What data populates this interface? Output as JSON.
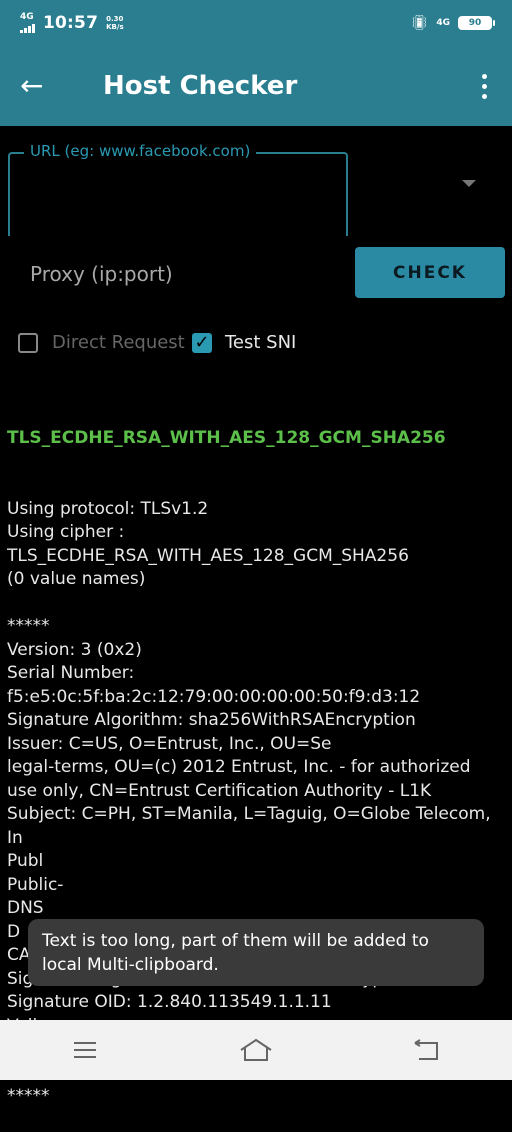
{
  "status": {
    "network": "4G",
    "time": "10:57",
    "speed_value": "0.30",
    "speed_unit": "KB/s",
    "network_right": "4G",
    "battery": "90"
  },
  "appbar": {
    "title": "Host Checker"
  },
  "form": {
    "url_label": "URL (eg: www.facebook.com)",
    "proxy_placeholder": "Proxy (ip:port)",
    "check_label": "CHECK",
    "direct_request_label": "Direct Request",
    "test_sni_label": "Test SNI"
  },
  "output": {
    "cipher_header": "TLS_ECDHE_RSA_WITH_AES_128_GCM_SHA256",
    "lines": [
      "Using protocol: TLSv1.2",
      "Using cipher :",
      "TLS_ECDHE_RSA_WITH_AES_128_GCM_SHA256",
      "(0 value names)",
      "",
      "*****",
      "Version: 3 (0x2)",
      "Serial Number:",
      "f5:e5:0c:5f:ba:2c:12:79:00:00:00:00:50:f9:d3:12",
      "Signature Algorithm: sha256WithRSAEncryption",
      "Issuer: C=US, O=Entrust, Inc., OU=Se",
      "legal-terms, OU=(c) 2012 Entrust, Inc. - for authorized",
      "use only, CN=Entrust Certification Authority - L1K",
      "Subject: C=PH, ST=Manila, L=Taguig, O=Globe Telecom,",
      "In",
      "Publ",
      "Public-",
      "DNS",
      "D                                  nerment",
      "CA Issuers - URI:http://aia.entrust.net/l1k-chain256.cer",
      "Signature Algorithm: sha256WithRSAEncryption",
      "Signature OID: 1.2.840.113549.1.1.11",
      "Vali",
      "*****",
      "",
      "*****"
    ]
  },
  "toast": {
    "message": "Text is too long, part of them will be added to local Multi-clipboard."
  },
  "colors": {
    "primary": "#2a7e90",
    "accent": "#2a9ab3",
    "cipher_green": "#5cbf4a"
  }
}
